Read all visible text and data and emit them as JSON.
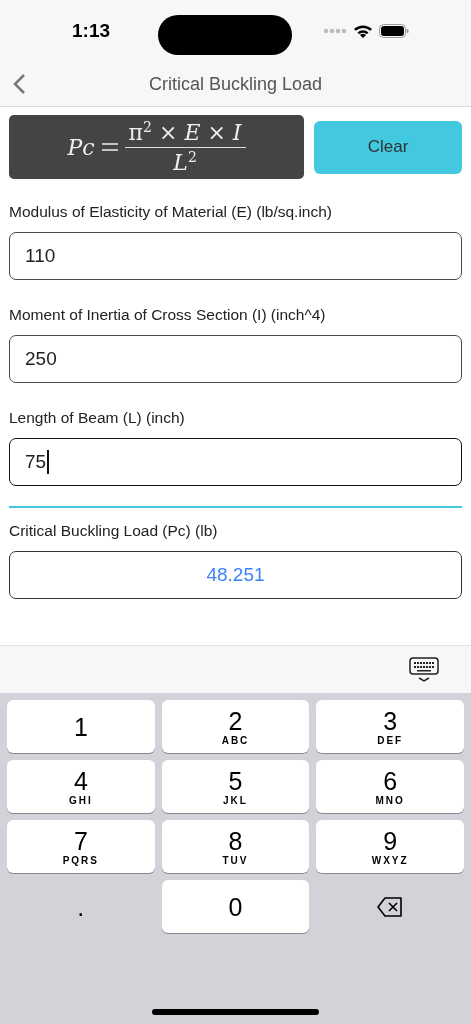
{
  "status_bar": {
    "time": "1:13"
  },
  "nav": {
    "title": "Critical Buckling Load"
  },
  "formula": {
    "lhs": "Pc",
    "numerator": "π$^{2}$ × *E* × *I*",
    "denominator": "*L*$^{2}$"
  },
  "clear_button": {
    "label": "Clear"
  },
  "inputs": [
    {
      "label": "Modulus of Elasticity of Material (E) (lb/sq.inch)",
      "value": "110",
      "focused": false
    },
    {
      "label": "Moment of Inertia of Cross Section (I) (inch^4)",
      "value": "250",
      "focused": false
    },
    {
      "label": "Length of Beam (L) (inch)",
      "value": "75",
      "focused": true
    }
  ],
  "result": {
    "label": "Critical Buckling Load (Pc) (lb)",
    "value": "48.251"
  },
  "keyboard": {
    "rows": [
      [
        {
          "kind": "digit",
          "digit": "1"
        },
        {
          "kind": "digit",
          "digit": "2",
          "letters": "ABC"
        },
        {
          "kind": "digit",
          "digit": "3",
          "letters": "DEF"
        }
      ],
      [
        {
          "kind": "digit",
          "digit": "4",
          "letters": "GHI"
        },
        {
          "kind": "digit",
          "digit": "5",
          "letters": "JKL"
        },
        {
          "kind": "digit",
          "digit": "6",
          "letters": "MNO"
        }
      ],
      [
        {
          "kind": "digit",
          "digit": "7",
          "letters": "PQRS"
        },
        {
          "kind": "digit",
          "digit": "8",
          "letters": "TUV"
        },
        {
          "kind": "digit",
          "digit": "9",
          "letters": "WXYZ"
        }
      ],
      [
        {
          "kind": "decimal",
          "digit": "."
        },
        {
          "kind": "digit",
          "digit": "0"
        },
        {
          "kind": "delete"
        }
      ]
    ]
  }
}
